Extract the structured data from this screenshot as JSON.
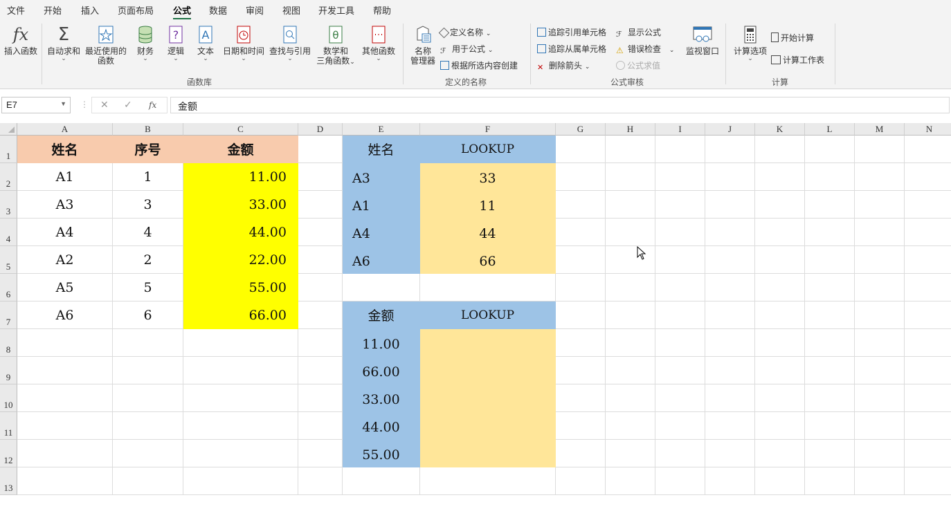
{
  "menu": [
    "文件",
    "开始",
    "插入",
    "页面布局",
    "公式",
    "数据",
    "审阅",
    "视图",
    "开发工具",
    "帮助"
  ],
  "active_menu": "公式",
  "ribbon": {
    "insert_function": "插入函数",
    "autosum": "自动求和",
    "recent_1": "最近使用的",
    "recent_2": "函数",
    "finance": "财务",
    "logic": "逻辑",
    "text": "文本",
    "datetime": "日期和时间",
    "lookup_ref": "查找与引用",
    "math_1": "数学和",
    "math_2": "三角函数",
    "other": "其他函数",
    "group_function_library": "函数库",
    "name_mgr_1": "名称",
    "name_mgr_2": "管理器",
    "define_name": "定义名称",
    "use_in_formula": "用于公式",
    "create_from_selection": "根据所选内容创建",
    "group_defined_names": "定义的名称",
    "trace_precedents": "追踪引用单元格",
    "trace_dependents": "追踪从属单元格",
    "remove_arrows": "删除箭头",
    "show_formulas": "显示公式",
    "error_checking": "错误检查",
    "evaluate_formula": "公式求值",
    "watch_window": "监视窗口",
    "group_formula_auditing": "公式审核",
    "calc_options": "计算选项",
    "calc_now": "开始计算",
    "calc_sheet": "计算工作表",
    "group_calculation": "计算"
  },
  "formula_bar": {
    "name_box": "E7",
    "content": "金额",
    "fx": "fx"
  },
  "columns": [
    "A",
    "B",
    "C",
    "D",
    "E",
    "F",
    "G",
    "H",
    "I",
    "J",
    "K",
    "L",
    "M",
    "N"
  ],
  "rows": [
    "1",
    "2",
    "3",
    "4",
    "5",
    "6",
    "7",
    "8",
    "9",
    "10",
    "11",
    "12",
    "13"
  ],
  "table1": {
    "headers": [
      "姓名",
      "序号",
      "金额"
    ],
    "rows": [
      [
        "A1",
        "1",
        "11.00"
      ],
      [
        "A3",
        "3",
        "33.00"
      ],
      [
        "A4",
        "4",
        "44.00"
      ],
      [
        "A2",
        "2",
        "22.00"
      ],
      [
        "A5",
        "5",
        "55.00"
      ],
      [
        "A6",
        "6",
        "66.00"
      ]
    ]
  },
  "table2": {
    "headers": [
      "姓名",
      "LOOKUP"
    ],
    "rows": [
      [
        "A3",
        "33"
      ],
      [
        "A1",
        "11"
      ],
      [
        "A4",
        "44"
      ],
      [
        "A6",
        "66"
      ]
    ]
  },
  "table3": {
    "headers": [
      "金额",
      "LOOKUP"
    ],
    "rows": [
      [
        "11.00",
        ""
      ],
      [
        "66.00",
        ""
      ],
      [
        "33.00",
        ""
      ],
      [
        "44.00",
        ""
      ],
      [
        "55.00",
        ""
      ]
    ]
  },
  "colors": {
    "header_orange": "#f8cbad",
    "yellow": "#ffff00",
    "blue": "#9dc3e6",
    "light_yellow": "#ffe699",
    "accent_green": "#1e7145"
  }
}
